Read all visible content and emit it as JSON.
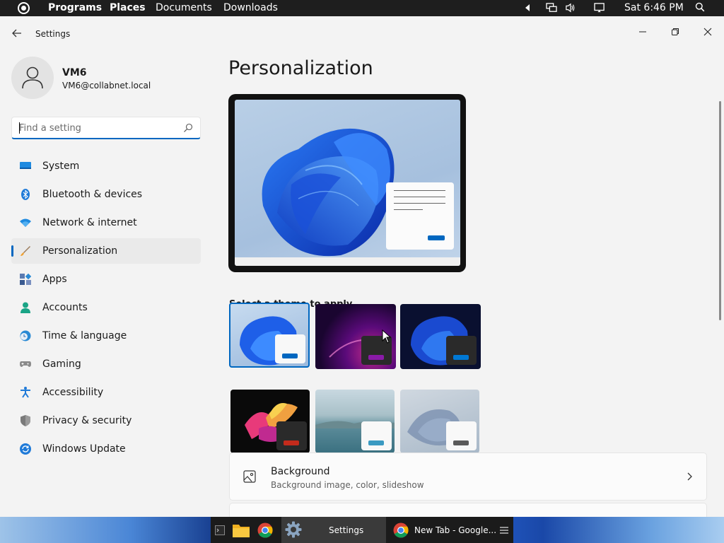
{
  "topbar": {
    "menus": [
      "Programs",
      "Places",
      "Documents",
      "Downloads"
    ],
    "clock": "Sat 6:46 PM",
    "icons": [
      "activities-icon",
      "volume-arrow-icon",
      "network-icon",
      "speaker-icon",
      "display-icon",
      "search-icon"
    ]
  },
  "window": {
    "title": "Settings",
    "controls": [
      "minimize",
      "maximize",
      "close"
    ]
  },
  "user": {
    "name": "VM6",
    "email": "VM6@collabnet.local"
  },
  "search": {
    "placeholder": "Find a setting",
    "value": ""
  },
  "nav": {
    "items": [
      {
        "label": "System",
        "icon": "monitor-icon",
        "color": "#0078d4"
      },
      {
        "label": "Bluetooth & devices",
        "icon": "bluetooth-icon",
        "color": "#0078d4"
      },
      {
        "label": "Network & internet",
        "icon": "wifi-icon",
        "color": "#0078d4"
      },
      {
        "label": "Personalization",
        "icon": "brush-icon",
        "color": "#e8a23a",
        "active": true
      },
      {
        "label": "Apps",
        "icon": "apps-icon",
        "color": "#4a6fa5"
      },
      {
        "label": "Accounts",
        "icon": "person-icon",
        "color": "#1aa486"
      },
      {
        "label": "Time & language",
        "icon": "globe-clock-icon",
        "color": "#2a8ad4"
      },
      {
        "label": "Gaming",
        "icon": "gamepad-icon",
        "color": "#7a7a7a"
      },
      {
        "label": "Accessibility",
        "icon": "accessibility-icon",
        "color": "#1f7ad8"
      },
      {
        "label": "Privacy & security",
        "icon": "shield-icon",
        "color": "#6d6d6d"
      },
      {
        "label": "Windows Update",
        "icon": "update-icon",
        "color": "#1f7ad8"
      }
    ]
  },
  "main": {
    "title": "Personalization",
    "theme_heading": "Select a theme to apply",
    "themes": [
      {
        "name": "windows-light",
        "accent": "#0067c0",
        "selected": true
      },
      {
        "name": "glow",
        "accent": "#8a1aa8"
      },
      {
        "name": "windows-dark",
        "accent": "#0078d4"
      },
      {
        "name": "captured-motion",
        "accent": "#c42b1c"
      },
      {
        "name": "sunrise",
        "accent": "#3a9ac2"
      },
      {
        "name": "flow",
        "accent": "#5a5a5a"
      }
    ],
    "background_card": {
      "title": "Background",
      "subtitle": "Background image, color, slideshow"
    }
  },
  "taskbar": {
    "items": [
      {
        "label": "",
        "icon": "terminal-icon"
      },
      {
        "label": "",
        "icon": "folder-icon"
      },
      {
        "label": "",
        "icon": "chrome-icon"
      },
      {
        "label": "Settings",
        "icon": "settings-gear-icon",
        "active": true
      },
      {
        "label": "New Tab - Google...",
        "icon": "chrome-icon"
      },
      {
        "label": "",
        "icon": "menu-icon"
      }
    ]
  },
  "colors": {
    "accent": "#0067c0",
    "window_bg": "#f3f3f3",
    "card_bg": "#fbfbfb"
  }
}
